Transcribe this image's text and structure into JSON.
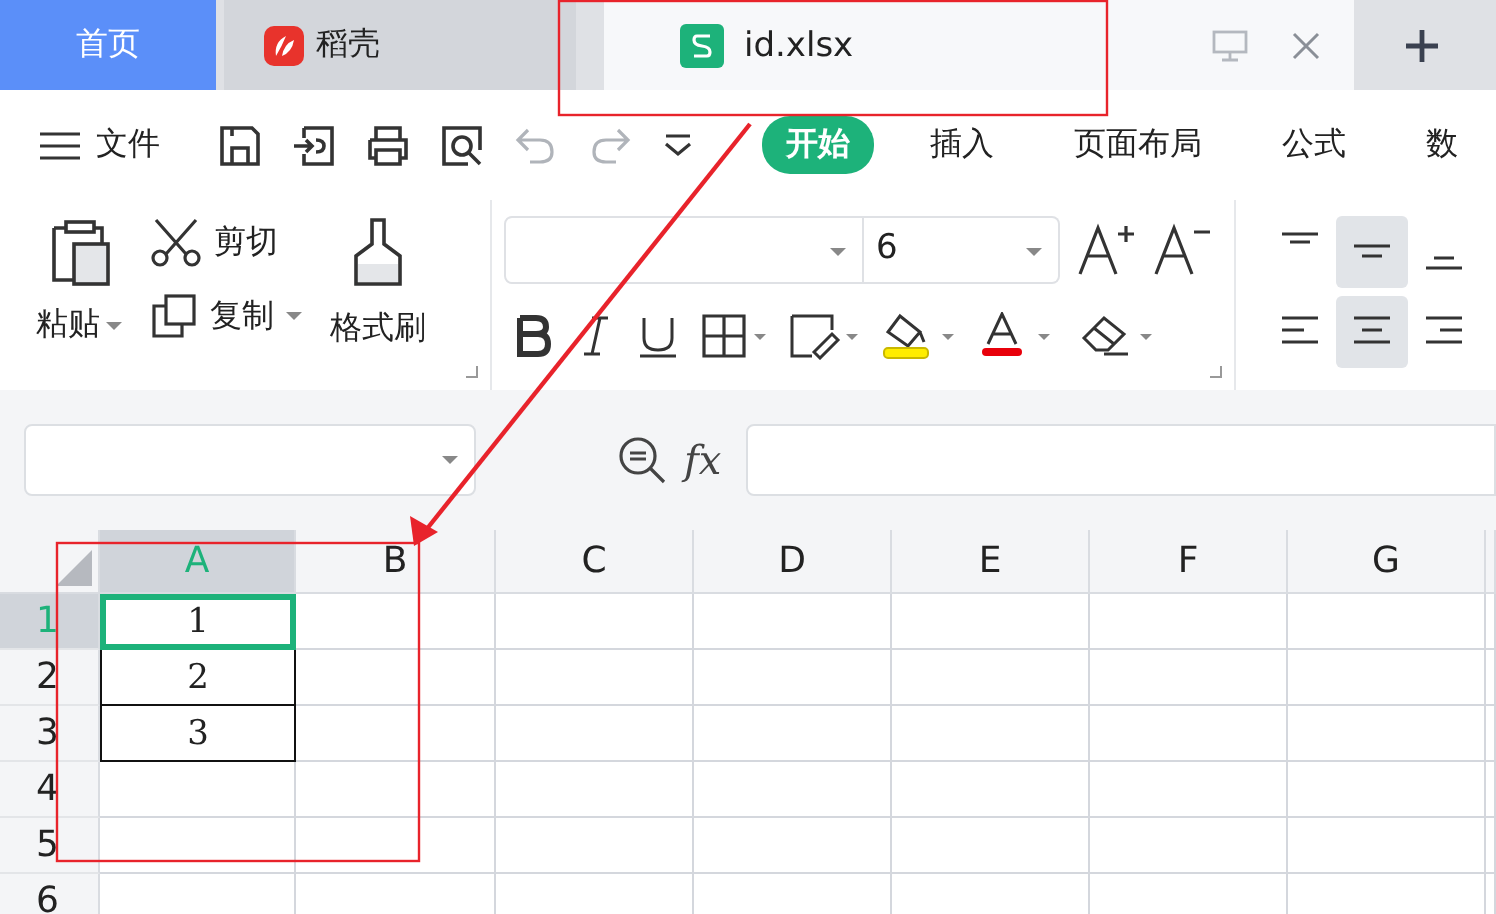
{
  "tabs": [
    {
      "label": "首页",
      "kind": "home",
      "selected": false
    },
    {
      "label": "稻壳",
      "kind": "docer",
      "selected": false
    },
    {
      "label": "id.xlsx",
      "kind": "sheet",
      "selected": true
    }
  ],
  "toolbar": {
    "file_label": "文件"
  },
  "ribbon_tabs": [
    {
      "label": "开始",
      "selected": true
    },
    {
      "label": "插入",
      "selected": false
    },
    {
      "label": "页面布局",
      "selected": false
    },
    {
      "label": "公式",
      "selected": false
    },
    {
      "label": "数",
      "selected": false
    }
  ],
  "clipboard": {
    "paste": "粘贴",
    "cut": "剪切",
    "copy": "复制",
    "format_painter": "格式刷"
  },
  "font": {
    "size": "6"
  },
  "align_vertical": [
    {
      "kind": "top",
      "selected": false
    },
    {
      "kind": "middle",
      "selected": true
    },
    {
      "kind": "bottom",
      "selected": false
    }
  ],
  "align_horizontal": [
    {
      "kind": "left",
      "selected": false
    },
    {
      "kind": "center",
      "selected": true
    },
    {
      "kind": "right",
      "selected": false
    }
  ],
  "formula_bar": {
    "fx_label": "fx"
  },
  "columns": [
    {
      "label": "A",
      "selected": true
    },
    {
      "label": "B",
      "selected": false
    },
    {
      "label": "C",
      "selected": false
    },
    {
      "label": "D",
      "selected": false
    },
    {
      "label": "E",
      "selected": false
    },
    {
      "label": "F",
      "selected": false
    },
    {
      "label": "G",
      "selected": false
    }
  ],
  "rows": [
    {
      "label": "1",
      "selected": true,
      "cells": [
        "1"
      ]
    },
    {
      "label": "2",
      "selected": false,
      "cells": [
        "2"
      ]
    },
    {
      "label": "3",
      "selected": false,
      "cells": [
        "3"
      ]
    },
    {
      "label": "4",
      "selected": false,
      "cells": []
    },
    {
      "label": "5",
      "selected": false,
      "cells": []
    },
    {
      "label": "6",
      "selected": false,
      "cells": []
    }
  ]
}
